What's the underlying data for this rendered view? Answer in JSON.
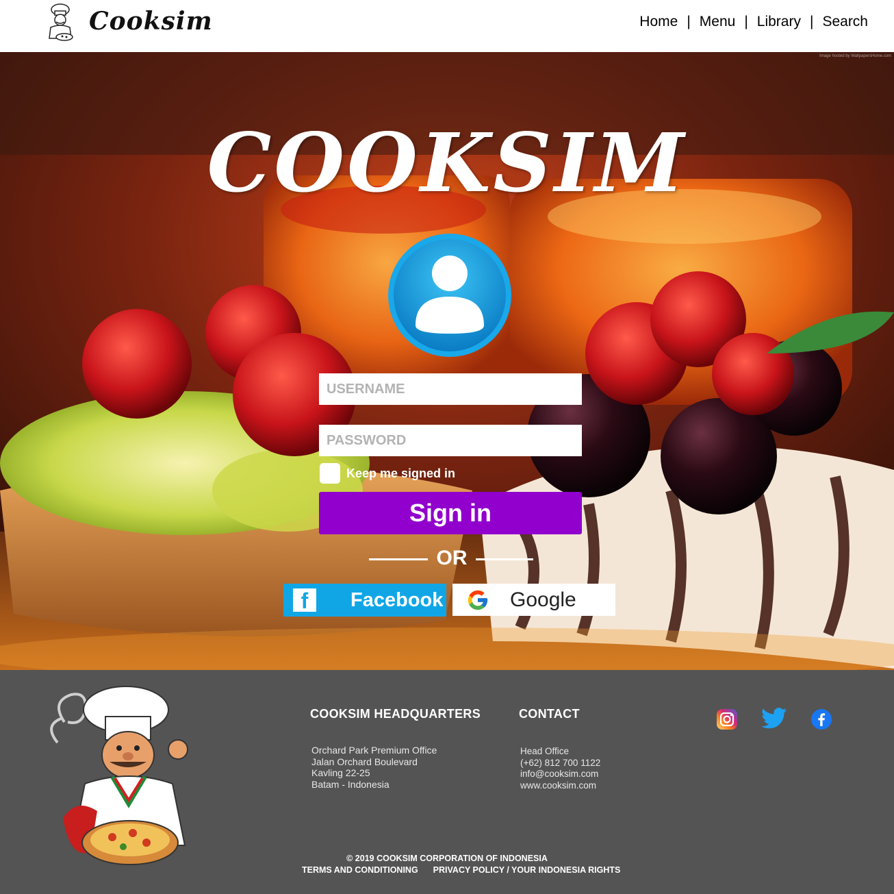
{
  "header": {
    "brand": "Cooksim",
    "nav": [
      "Home",
      "Menu",
      "Library",
      "Search"
    ],
    "separator": "|"
  },
  "hero": {
    "image_credit": "Image hosted by WallpapersHome.com",
    "title": "COOKSIM",
    "username_placeholder": "USERNAME",
    "password_placeholder": "PASSWORD",
    "keep_signed_in": "Keep me signed in",
    "signin_label": "Sign in",
    "or_label": "OR",
    "facebook_label": "Facebook",
    "facebook_glyph": "f",
    "google_label": "Google"
  },
  "footer": {
    "hq_title": "COOKSIM HEADQUARTERS",
    "hq_lines": [
      "Orchard Park Premium Office",
      "Jalan Orchard Boulevard",
      "Kavling 22-25",
      "Batam - Indonesia"
    ],
    "contact_title": "CONTACT",
    "contact_lines": [
      "Head Office",
      "(+62) 812 700 1122",
      "info@cooksim.com",
      "www.cooksim.com"
    ],
    "copyright": "© 2019 COOKSIM CORPORATION OF INDONESIA",
    "terms": "TERMS AND CONDITIONING",
    "privacy": "PRIVACY POLICY / YOUR INDONESIA RIGHTS"
  },
  "icons": {
    "header_logo": "chef-logo-icon",
    "avatar": "user-avatar-icon",
    "facebook": "facebook-icon",
    "google": "google-icon",
    "instagram": "instagram-icon",
    "twitter": "twitter-icon",
    "footer_facebook": "facebook-icon",
    "footer_chef": "chef-mascot-icon"
  },
  "colors": {
    "signin_button": "#9100cc",
    "facebook_button": "#10a6e6",
    "footer_background": "#545454",
    "avatar_ring": "#1aa6e8"
  }
}
